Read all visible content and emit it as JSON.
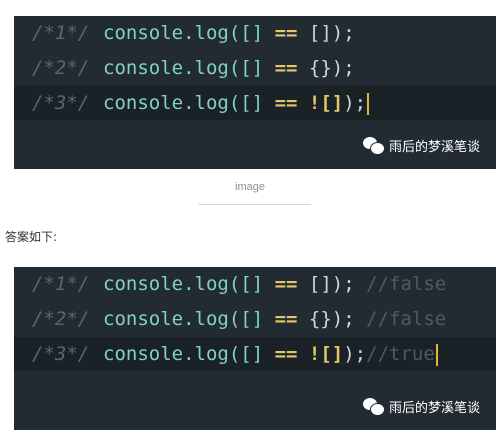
{
  "block1": {
    "lines": [
      {
        "num": "/*1*/",
        "prefix": "console.log([] ",
        "op": "==",
        "arg": " []);"
      },
      {
        "num": "/*2*/",
        "prefix": "console.log([] ",
        "op": "==",
        "arg": " {});"
      },
      {
        "num": "/*3*/",
        "prefix": "console.log([] ",
        "op": "== ![]",
        "arg": ");"
      }
    ],
    "watermark": "雨后的梦溪笔谈"
  },
  "caption": "image",
  "answer_label": "答案如下:",
  "block2": {
    "lines": [
      {
        "num": "/*1*/",
        "prefix": "console.log([] ",
        "op": "==",
        "arg": " []);",
        "comment": " //false"
      },
      {
        "num": "/*2*/",
        "prefix": "console.log([] ",
        "op": "==",
        "arg": " {});",
        "comment": " //false"
      },
      {
        "num": "/*3*/",
        "prefix": "console.log([] ",
        "op": "== ![]",
        "arg": ");",
        "comment": "//true"
      }
    ],
    "watermark": "雨后的梦溪笔谈"
  },
  "colors": {
    "code_bg": "#232b32",
    "keyword": "#7fd2c4",
    "operator": "#e3c86a",
    "comment": "#4d5a64",
    "caret": "#e8b634"
  }
}
